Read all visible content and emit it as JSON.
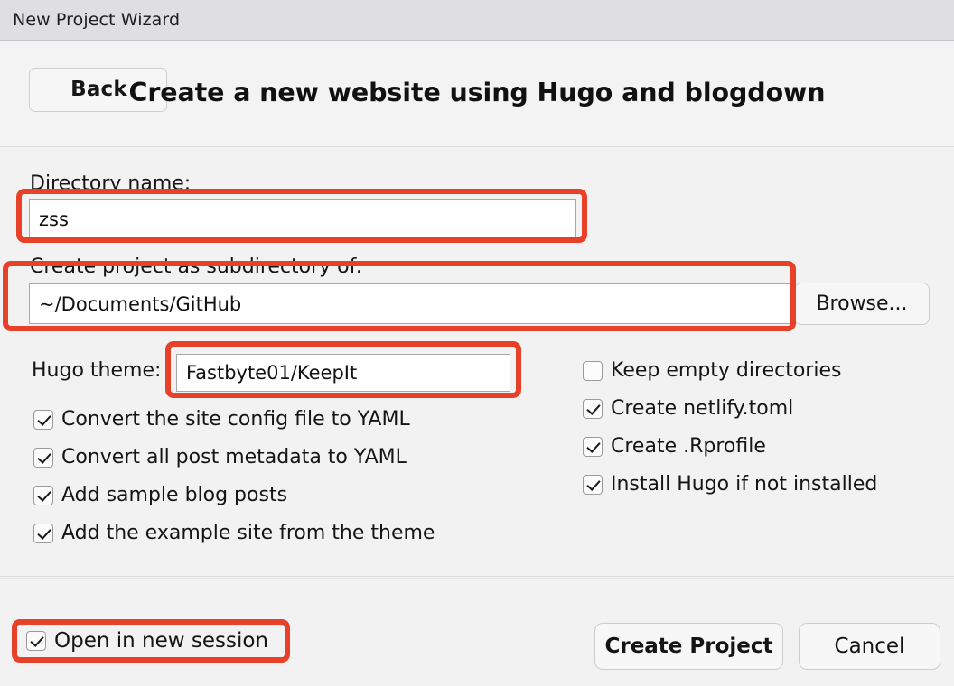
{
  "window": {
    "title": "New Project Wizard"
  },
  "header": {
    "back_label": "Back",
    "title": "Create a new website using Hugo and blogdown"
  },
  "form": {
    "directory": {
      "label": "Directory name:",
      "value": "zss",
      "placeholder": ""
    },
    "subdirectory": {
      "label": "Create project as subdirectory of:",
      "value": "~/Documents/GitHub",
      "placeholder": "",
      "browse_label": "Browse..."
    },
    "theme": {
      "label": "Hugo theme:",
      "value": "Fastbyte01/KeepIt",
      "placeholder": ""
    },
    "options_left": [
      {
        "label": "Convert the site config file to YAML",
        "checked": true
      },
      {
        "label": "Convert all post metadata to YAML",
        "checked": true
      },
      {
        "label": "Add sample blog posts",
        "checked": true
      },
      {
        "label": "Add the example site from the theme",
        "checked": true
      }
    ],
    "options_right": [
      {
        "label": "Keep empty directories",
        "checked": false
      },
      {
        "label": "Create netlify.toml",
        "checked": true
      },
      {
        "label": "Create .Rprofile",
        "checked": true
      },
      {
        "label": "Install Hugo if not installed",
        "checked": true
      }
    ]
  },
  "footer": {
    "open_session": {
      "label": "Open in new session",
      "checked": true
    },
    "create_label": "Create Project",
    "cancel_label": "Cancel"
  },
  "annotations": {
    "color": "#e8412a"
  }
}
